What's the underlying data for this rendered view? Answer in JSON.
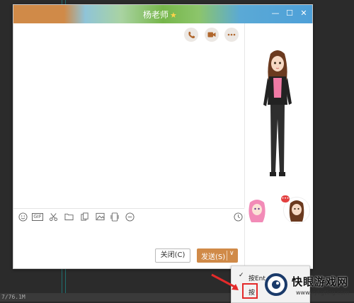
{
  "window": {
    "title": "杨老师",
    "accent_color": "#d08a48"
  },
  "icons": {
    "top_actions": [
      "phone-icon",
      "video-call-icon",
      "more-icon"
    ],
    "toolbar": [
      "emoji-icon",
      "gif-icon",
      "screenshot-scissors-icon",
      "folder-icon",
      "document-icon",
      "image-icon",
      "screen-record-icon",
      "more-circle-icon",
      "history-clock-icon"
    ]
  },
  "toolbar": {
    "gif_label": "GIF"
  },
  "buttons": {
    "close_label": "关闭(C)",
    "send_label": "发送(S)"
  },
  "popup": {
    "item1": "按Ent",
    "item2": "按"
  },
  "status": {
    "text": "7/76.1M"
  },
  "watermark": {
    "title": "快眼游戏网",
    "url": "www.kyligting.com"
  }
}
